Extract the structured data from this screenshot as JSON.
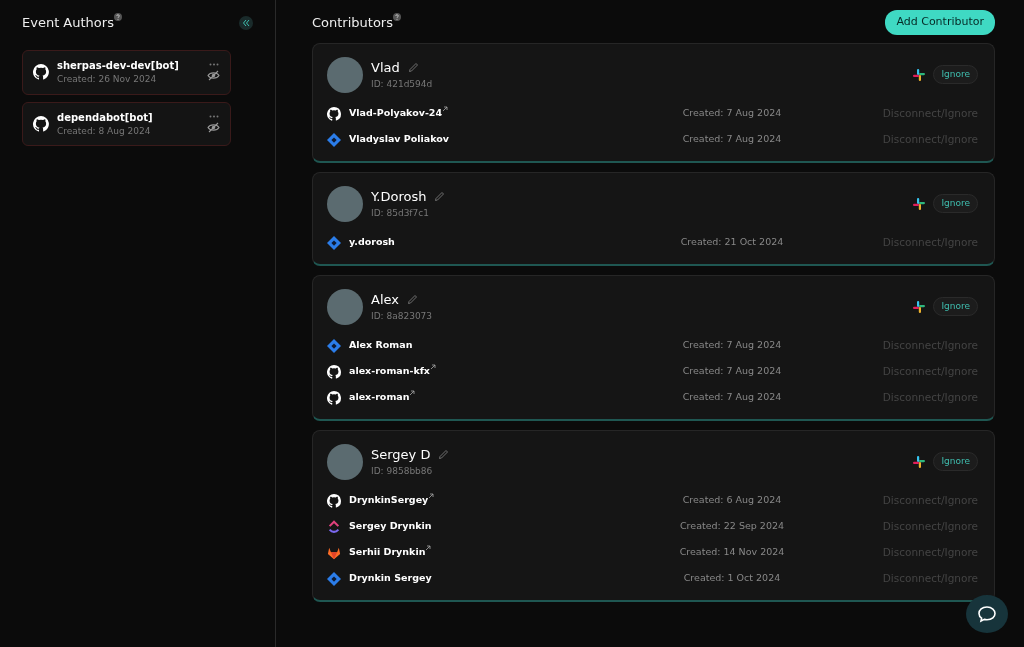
{
  "event_authors": {
    "title": "Event Authors",
    "items": [
      {
        "name": "sherpas-dev-dev[bot]",
        "created": "Created: 26 Nov 2024",
        "kind": "github"
      },
      {
        "name": "dependabot[bot]",
        "created": "Created: 8 Aug 2024",
        "kind": "github"
      }
    ]
  },
  "contributors": {
    "title": "Contributors",
    "add_button": "Add Contributor",
    "items": [
      {
        "name": "Vlad",
        "id": "ID: 421d594d",
        "ignore": "Ignore",
        "accounts": [
          {
            "kind": "github",
            "name": "Vlad-Polyakov-24",
            "external": true,
            "created": "Created: 7 Aug 2024",
            "action": "Disconnect/Ignore"
          },
          {
            "kind": "jira",
            "name": "Vladyslav Poliakov",
            "external": false,
            "created": "Created: 7 Aug 2024",
            "action": "Disconnect/Ignore"
          }
        ]
      },
      {
        "name": "Y.Dorosh",
        "id": "ID: 85d3f7c1",
        "ignore": "Ignore",
        "accounts": [
          {
            "kind": "jira",
            "name": "y.dorosh",
            "external": false,
            "created": "Created: 21 Oct 2024",
            "action": "Disconnect/Ignore"
          }
        ]
      },
      {
        "name": "Alex",
        "id": "ID: 8a823073",
        "ignore": "Ignore",
        "accounts": [
          {
            "kind": "jira",
            "name": "Alex Roman",
            "external": false,
            "created": "Created: 7 Aug 2024",
            "action": "Disconnect/Ignore"
          },
          {
            "kind": "github",
            "name": "alex-roman-kfx",
            "external": true,
            "created": "Created: 7 Aug 2024",
            "action": "Disconnect/Ignore"
          },
          {
            "kind": "github",
            "name": "alex-roman",
            "external": true,
            "created": "Created: 7 Aug 2024",
            "action": "Disconnect/Ignore"
          }
        ]
      },
      {
        "name": "Sergey D",
        "id": "ID: 9858bb86",
        "ignore": "Ignore",
        "accounts": [
          {
            "kind": "github",
            "name": "DrynkinSergey",
            "external": true,
            "created": "Created: 6 Aug 2024",
            "action": "Disconnect/Ignore"
          },
          {
            "kind": "clickup",
            "name": "Sergey Drynkin",
            "external": false,
            "created": "Created: 22 Sep 2024",
            "action": "Disconnect/Ignore"
          },
          {
            "kind": "gitlab",
            "name": "Serhii Drynkin",
            "external": true,
            "created": "Created: 14 Nov 2024",
            "action": "Disconnect/Ignore"
          },
          {
            "kind": "jira",
            "name": "Drynkin Sergey",
            "external": false,
            "created": "Created: 1 Oct 2024",
            "action": "Disconnect/Ignore"
          }
        ]
      }
    ]
  }
}
